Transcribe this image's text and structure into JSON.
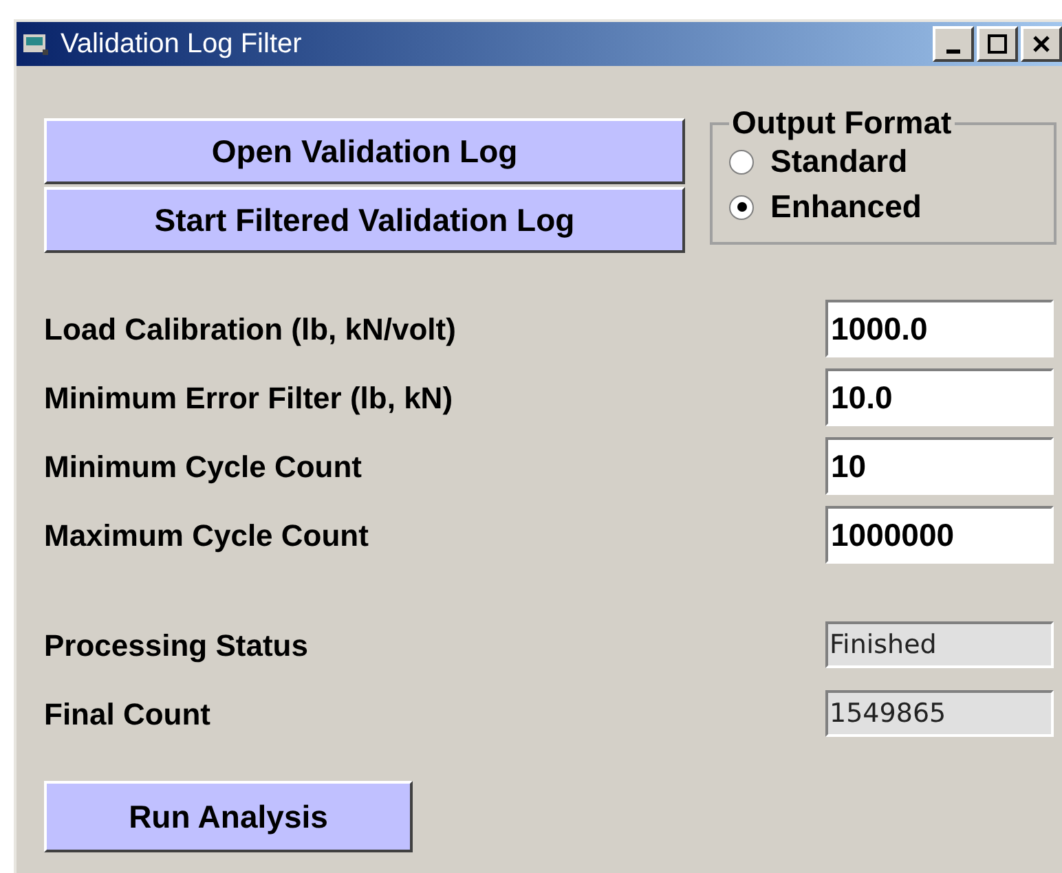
{
  "window": {
    "title": "Validation Log Filter"
  },
  "top_buttons": [
    "Open Validation Log",
    "Start Filtered Validation Log"
  ],
  "output_format": {
    "title": "Output Format",
    "options": [
      {
        "label": "Standard",
        "selected": false
      },
      {
        "label": "Enhanced",
        "selected": true
      }
    ]
  },
  "inputs": [
    {
      "label": "Load Calibration (lb, kN/volt)",
      "value": "1000.0"
    },
    {
      "label": "Minimum Error Filter (lb, kN)",
      "value": "10.0"
    },
    {
      "label": "Minimum Cycle Count",
      "value": "10"
    },
    {
      "label": "Maximum Cycle Count",
      "value": "1000000"
    }
  ],
  "outputs": [
    {
      "label": "Processing Status",
      "value": "Finished"
    },
    {
      "label": "Final Count",
      "value": "1549865"
    }
  ],
  "run_button": "Run Analysis"
}
